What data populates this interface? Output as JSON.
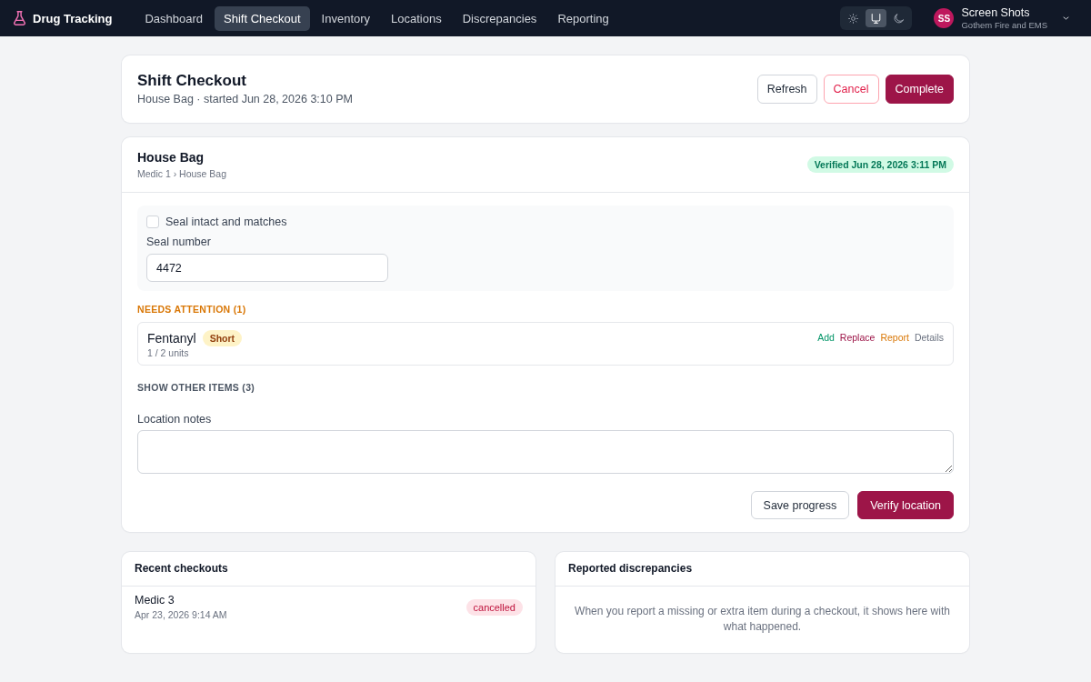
{
  "nav": {
    "brand": "Drug Tracking",
    "items": [
      {
        "label": "Dashboard",
        "selected": false
      },
      {
        "label": "Shift Checkout",
        "selected": true
      },
      {
        "label": "Inventory",
        "selected": false
      },
      {
        "label": "Locations",
        "selected": false
      },
      {
        "label": "Discrepancies",
        "selected": false
      },
      {
        "label": "Reporting",
        "selected": false
      }
    ],
    "theme_toggle": [
      {
        "kind": "light",
        "selected": false
      },
      {
        "kind": "system",
        "selected": true
      },
      {
        "kind": "dark",
        "selected": false
      }
    ],
    "user": {
      "initials": "SS",
      "name": "Screen Shots",
      "org": "Gothem Fire and EMS"
    }
  },
  "header": {
    "title": "Shift Checkout",
    "subtitle": "House Bag · started Jun 28, 2026 3:10 PM",
    "buttons": [
      {
        "label": "Refresh",
        "kind": "default"
      },
      {
        "label": "Cancel",
        "kind": "danger"
      },
      {
        "label": "Complete",
        "kind": "primary"
      }
    ]
  },
  "location": {
    "name": "House Bag",
    "path": "Medic 1 › House Bag",
    "status": {
      "label": "Verified Jun 28, 2026 3:11 PM",
      "kind": "success"
    },
    "seal_check": {
      "label": "Seal intact and matches",
      "checked": false
    },
    "seal_number": {
      "label": "Seal number",
      "value": "4472"
    },
    "needs_attention": {
      "heading": "NEEDS ATTENTION (1)",
      "items": [
        {
          "name": "Fentanyl",
          "badge": {
            "label": "Short",
            "kind": "warning"
          },
          "count": "1 / 2 units",
          "actions": [
            {
              "label": "Add",
              "kind": "add"
            },
            {
              "label": "Replace",
              "kind": "replace"
            },
            {
              "label": "Report",
              "kind": "report"
            },
            {
              "label": "Details",
              "kind": "details"
            }
          ]
        }
      ]
    },
    "show_other": "SHOW OTHER ITEMS (3)",
    "notes": {
      "label": "Location notes"
    },
    "buttons": [
      {
        "label": "Save progress",
        "kind": "default"
      },
      {
        "label": "Verify location",
        "kind": "primary"
      }
    ]
  },
  "recent_checkouts": {
    "title": "Recent checkouts",
    "rows": [
      {
        "name": "Medic 3",
        "time": "Apr 23, 2026 9:14 AM",
        "status": {
          "label": "cancelled",
          "kind": "danger"
        }
      }
    ]
  },
  "reported_discrepancies": {
    "title": "Reported discrepancies",
    "empty_message": "When you report a missing or extra item during a checkout, it shows here with what happened."
  }
}
